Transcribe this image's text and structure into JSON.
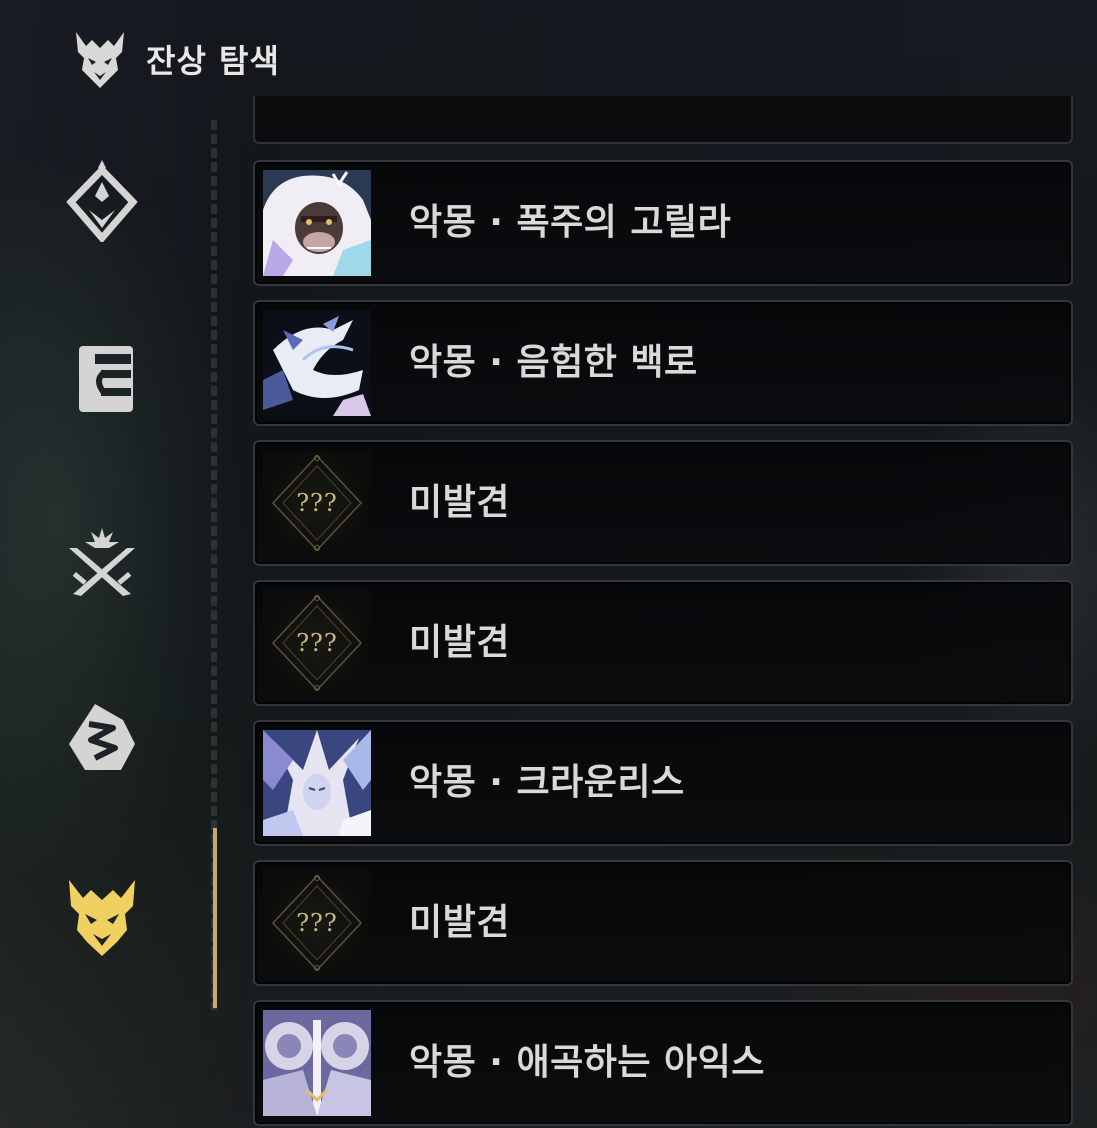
{
  "header": {
    "title": "잔상 탐색",
    "icon": "demon-mask-icon"
  },
  "nav": {
    "items": [
      {
        "icon": "diamond-crest-icon"
      },
      {
        "icon": "card-frame-icon"
      },
      {
        "icon": "crossed-swords-icon"
      },
      {
        "icon": "cracked-gem-icon"
      },
      {
        "icon": "demon-mask-icon",
        "active": true
      }
    ],
    "active_color": "#f0d060"
  },
  "list": {
    "items": [
      {
        "name": "악몽 · 폭주의 고릴라",
        "discovered": true,
        "portrait": "white-gorilla-portrait"
      },
      {
        "name": "악몽 · 음험한 백로",
        "discovered": true,
        "portrait": "egret-portrait"
      },
      {
        "name": "미발견",
        "discovered": false,
        "placeholder": "???"
      },
      {
        "name": "미발견",
        "discovered": false,
        "placeholder": "???"
      },
      {
        "name": "악몽 · 크라운리스",
        "discovered": true,
        "portrait": "crownless-portrait"
      },
      {
        "name": "미발견",
        "discovered": false,
        "placeholder": "???"
      },
      {
        "name": "악몽 · 애곡하는 아익스",
        "discovered": true,
        "portrait": "aix-portrait"
      }
    ]
  }
}
